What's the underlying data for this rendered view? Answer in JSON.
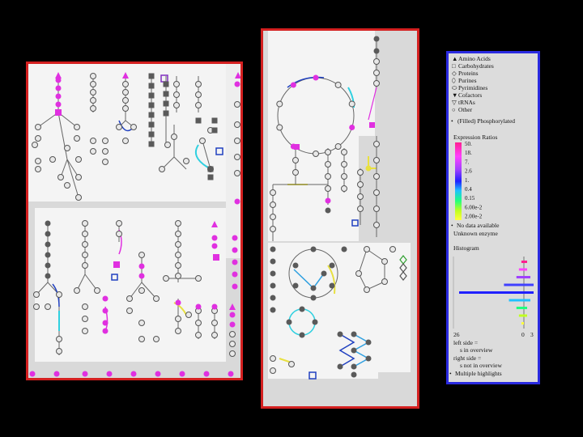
{
  "legend": {
    "categories": [
      {
        "symbol": "▲",
        "label": "Amino Acids"
      },
      {
        "symbol": "□",
        "label": "Carbohydrates"
      },
      {
        "symbol": "◇",
        "label": "Proteins"
      },
      {
        "symbol": "⬯",
        "label": "Purines"
      },
      {
        "symbol": "⬭",
        "label": "Pyrimidines"
      },
      {
        "symbol": "▼",
        "label": "Cofactors"
      },
      {
        "symbol": "▽",
        "label": "tRNAs"
      },
      {
        "symbol": "○",
        "label": "Other"
      }
    ],
    "filled_note": "(Filled) Phosphorylated",
    "expression_title": "Expression Ratios",
    "ramp_values": [
      "50.",
      "18.",
      "7.",
      "2.6",
      "1.",
      "0.4",
      "0.15",
      "6.00e-2",
      "2.00e-2"
    ],
    "no_data": "No data available",
    "unknown": "Unknown enzyme",
    "histogram_title": "Histogram",
    "hist_left": "26",
    "hist_mid": "0",
    "hist_right": "3",
    "left_side_1": "left side =",
    "left_side_2": "s in overview",
    "right_side_1": "right side =",
    "right_side_2": "s not in overview",
    "multiple": "Multiple highlights"
  },
  "colors": {
    "panel_border_left": "#d42020",
    "panel_border_mid": "#d42020",
    "panel_border_right": "#2a2ae0",
    "node_gray": "#5a5a5a",
    "magenta": "#e030e0",
    "blue": "#2040c0",
    "cyan": "#30d0e0",
    "yellow": "#e8e040"
  },
  "histogram": {
    "bins_ratio": [
      "50",
      "18",
      "7",
      "2.6",
      "1",
      "0.4",
      "0.15",
      "0.06",
      "0.02"
    ],
    "left_counts": [
      1,
      2,
      3,
      8,
      26,
      6,
      3,
      2,
      1
    ],
    "right_counts": [
      1,
      1,
      2,
      3,
      3,
      2,
      1,
      1,
      0
    ]
  }
}
